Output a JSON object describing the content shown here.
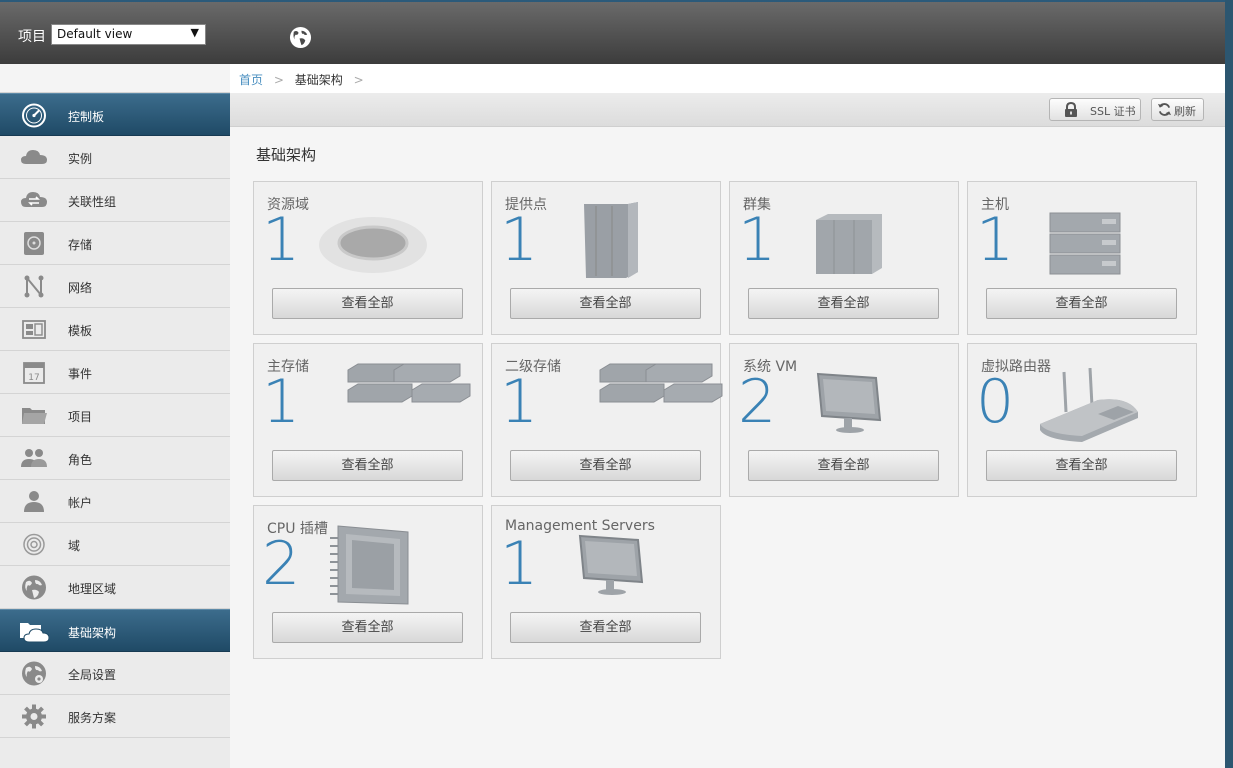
{
  "header": {
    "project_label": "项目",
    "view_select_value": "Default view"
  },
  "sidebar": {
    "items": [
      {
        "label": "控制板",
        "icon": "dashboard-icon",
        "active": true
      },
      {
        "label": "实例",
        "icon": "cloud-icon"
      },
      {
        "label": "关联性组",
        "icon": "affinity-cloud-icon"
      },
      {
        "label": "存储",
        "icon": "storage-disk-icon"
      },
      {
        "label": "网络",
        "icon": "network-icon"
      },
      {
        "label": "模板",
        "icon": "template-icon"
      },
      {
        "label": "事件",
        "icon": "calendar-icon"
      },
      {
        "label": "项目",
        "icon": "folder-icon"
      },
      {
        "label": "角色",
        "icon": "users-icon"
      },
      {
        "label": "帐户",
        "icon": "user-icon"
      },
      {
        "label": "域",
        "icon": "domain-icon"
      },
      {
        "label": "地理区域",
        "icon": "globe-icon"
      },
      {
        "label": "基础架构",
        "icon": "infrastructure-icon",
        "active": true
      },
      {
        "label": "全局设置",
        "icon": "global-settings-icon"
      },
      {
        "label": "服务方案",
        "icon": "gear-icon"
      }
    ]
  },
  "breadcrumb": {
    "home": "首页",
    "separator": ">",
    "current": "基础架构"
  },
  "toolbar": {
    "ssl_label": "SSL 证书",
    "refresh_label": "刷新"
  },
  "main": {
    "section_title": "基础架构",
    "view_all_label": "查看全部",
    "cards": [
      {
        "title": "资源域",
        "count": "1",
        "image": "zone-icon"
      },
      {
        "title": "提供点",
        "count": "1",
        "image": "pod-icon"
      },
      {
        "title": "群集",
        "count": "1",
        "image": "cluster-icon"
      },
      {
        "title": "主机",
        "count": "1",
        "image": "host-icon"
      },
      {
        "title": "主存储",
        "count": "1",
        "image": "primary-storage-icon"
      },
      {
        "title": "二级存储",
        "count": "1",
        "image": "secondary-storage-icon"
      },
      {
        "title": "系统 VM",
        "count": "2",
        "image": "system-vm-icon"
      },
      {
        "title": "虚拟路由器",
        "count": "0",
        "image": "router-icon"
      },
      {
        "title": "CPU 插槽",
        "count": "2",
        "image": "cpu-socket-icon"
      },
      {
        "title": "Management Servers",
        "count": "1",
        "image": "management-server-icon"
      }
    ]
  },
  "colors": {
    "accent_blue": "#3a82b5",
    "active_nav": "#2c5670",
    "header_dark": "#3c3c3c"
  }
}
